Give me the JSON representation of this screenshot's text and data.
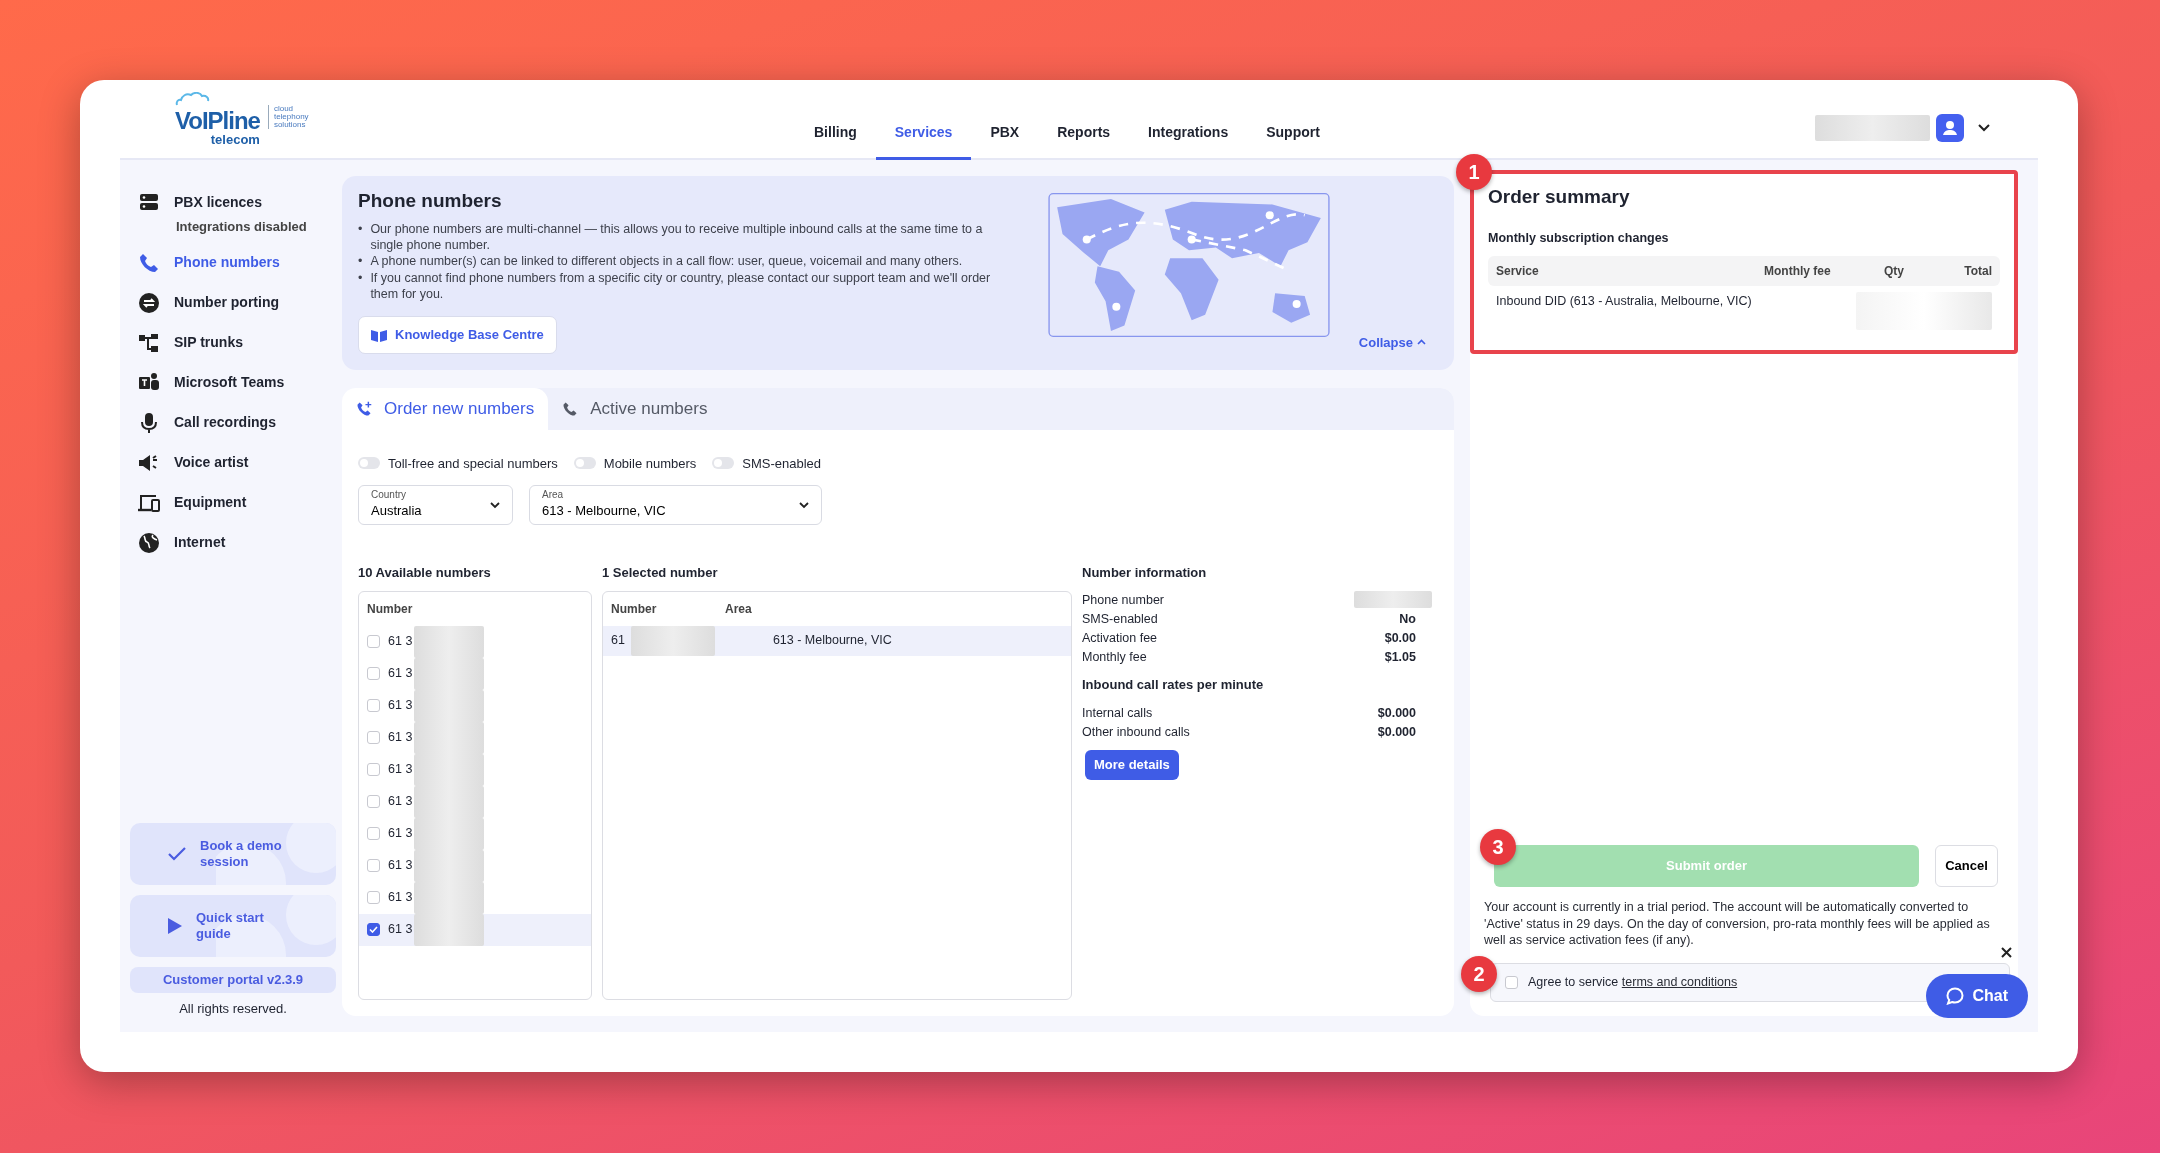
{
  "logo": {
    "name": "VoIPline",
    "sub": "telecom",
    "tagline": [
      "cloud",
      "telephony",
      "solutions"
    ]
  },
  "nav": [
    {
      "label": "Billing",
      "selected": false
    },
    {
      "label": "Services",
      "selected": true
    },
    {
      "label": "PBX",
      "selected": false
    },
    {
      "label": "Reports",
      "selected": false
    },
    {
      "label": "Integrations",
      "selected": false
    },
    {
      "label": "Support",
      "selected": false
    }
  ],
  "sidebar": {
    "items": [
      {
        "label": "PBX licences",
        "selected": false,
        "note": "Integrations disabled"
      },
      {
        "label": "Phone numbers",
        "selected": true
      },
      {
        "label": "Number porting",
        "selected": false
      },
      {
        "label": "SIP trunks",
        "selected": false
      },
      {
        "label": "Microsoft Teams",
        "selected": false
      },
      {
        "label": "Call recordings",
        "selected": false
      },
      {
        "label": "Voice artist",
        "selected": false
      },
      {
        "label": "Equipment",
        "selected": false
      },
      {
        "label": "Internet",
        "selected": false
      }
    ],
    "promos": [
      {
        "label": "Book a demo session",
        "kind": "demo"
      },
      {
        "label": "Quick start guide",
        "kind": "guide"
      }
    ],
    "version": "Customer portal v2.3.9",
    "footer": "All rights reserved."
  },
  "banner": {
    "title": "Phone numbers",
    "marker": "•",
    "bullets": [
      "Our phone numbers are multi-channel — this allows you to receive multiple inbound calls at the same time to a single phone number.",
      "A phone number(s) can be linked to different objects in a call flow: user, queue, voicemail and many others.",
      "If you cannot find phone numbers from a specific city or country, please contact our support team and we'll order them for you."
    ],
    "button": "Knowledge Base Centre",
    "collapse": "Collapse"
  },
  "tabs": [
    {
      "label": "Order new numbers",
      "selected": true
    },
    {
      "label": "Active numbers",
      "selected": false
    }
  ],
  "filters": [
    {
      "label": "Toll-free and special numbers",
      "on": false
    },
    {
      "label": "Mobile numbers",
      "on": false
    },
    {
      "label": "SMS-enabled",
      "on": false
    }
  ],
  "selects": [
    {
      "label": "Country",
      "value": "Australia"
    },
    {
      "label": "Area",
      "value": "613 - Melbourne, VIC"
    }
  ],
  "available": {
    "title": "10 Available numbers",
    "column": "Number",
    "rows": [
      {
        "number": "61 3",
        "checked": false
      },
      {
        "number": "61 3",
        "checked": false
      },
      {
        "number": "61 3",
        "checked": false
      },
      {
        "number": "61 3",
        "checked": false
      },
      {
        "number": "61 3",
        "checked": false
      },
      {
        "number": "61 3",
        "checked": false
      },
      {
        "number": "61 3",
        "checked": false
      },
      {
        "number": "61 3",
        "checked": false
      },
      {
        "number": "61 3",
        "checked": false
      },
      {
        "number": "61 3",
        "checked": true
      }
    ]
  },
  "chosen": {
    "title": "1 Selected number",
    "columns": [
      "Number",
      "Area"
    ],
    "rows": [
      {
        "number": "61",
        "area": "613 - Melbourne, VIC"
      }
    ]
  },
  "info": {
    "title": "Number information",
    "rows": [
      {
        "label": "Phone number"
      },
      {
        "label": "SMS-enabled",
        "value": "No"
      },
      {
        "label": "Activation fee",
        "value": "$0.00"
      },
      {
        "label": "Monthly fee",
        "value": "$1.05"
      }
    ],
    "rates_title": "Inbound call rates per minute",
    "rates": [
      {
        "label": "Internal calls",
        "value": "$0.000"
      },
      {
        "label": "Other inbound calls",
        "value": "$0.000"
      }
    ],
    "button": "More details"
  },
  "summary": {
    "title": "Order summary",
    "subtitle": "Monthly subscription changes",
    "columns": [
      "Service",
      "Monthly fee",
      "Qty",
      "Total"
    ],
    "rows": [
      {
        "service": "Inbound DID (613 - Australia, Melbourne, VIC)"
      }
    ]
  },
  "submit": {
    "label": "Submit order",
    "disabled": true
  },
  "cancel": "Cancel",
  "notice": "Your account is currently in a trial period. The account will be automatically converted to 'Active' status in 29 days. On the day of conversion, pro-rata monthly fees will be applied as well as service activation fees (if any).",
  "agree": {
    "text": "Agree to service",
    "link": "terms and conditions",
    "checked": false
  },
  "chat": "Chat",
  "markers": [
    "1",
    "2",
    "3"
  ]
}
